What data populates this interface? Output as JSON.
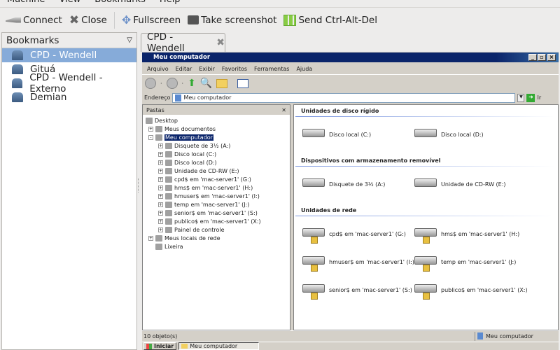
{
  "menubar": [
    "Machine",
    "View",
    "Bookmarks",
    "Help"
  ],
  "toolbar": {
    "connect": "Connect",
    "close": "Close",
    "fullscreen": "Fullscreen",
    "screenshot": "Take screenshot",
    "cad": "Send Ctrl-Alt-Del"
  },
  "bookmarks": {
    "title": "Bookmarks",
    "items": [
      {
        "label": "CPD - Wendell",
        "selected": true
      },
      {
        "label": "Gituá"
      },
      {
        "label": "CPD - Wendell - Externo"
      },
      {
        "label": "Demian"
      }
    ]
  },
  "tab": {
    "label": "CPD - Wendell"
  },
  "remote": {
    "title": "Meu computador",
    "menu": [
      "Arquivo",
      "Editar",
      "Exibir",
      "Favoritos",
      "Ferramentas",
      "Ajuda"
    ],
    "address_label": "Endereço",
    "address": "Meu computador",
    "go": "Ir",
    "folders_title": "Pastas",
    "tree": [
      {
        "label": "Desktop",
        "level": 0,
        "exp": ""
      },
      {
        "label": "Meus documentos",
        "level": 1,
        "exp": "+"
      },
      {
        "label": "Meu computador",
        "level": 1,
        "exp": "-",
        "selected": true
      },
      {
        "label": "Disquete de 3½ (A:)",
        "level": 2,
        "exp": "+"
      },
      {
        "label": "Disco local (C:)",
        "level": 2,
        "exp": "+"
      },
      {
        "label": "Disco local (D:)",
        "level": 2,
        "exp": "+"
      },
      {
        "label": "Unidade de CD-RW (E:)",
        "level": 2,
        "exp": "+"
      },
      {
        "label": "cpd$ em 'mac-server1' (G:)",
        "level": 2,
        "exp": "+"
      },
      {
        "label": "hms$ em 'mac-server1' (H:)",
        "level": 2,
        "exp": "+"
      },
      {
        "label": "hmuser$ em 'mac-server1' (I:)",
        "level": 2,
        "exp": "+"
      },
      {
        "label": "temp em 'mac-server1' (J:)",
        "level": 2,
        "exp": "+"
      },
      {
        "label": "senior$ em 'mac-server1' (S:)",
        "level": 2,
        "exp": "+"
      },
      {
        "label": "publico$ em 'mac-server1' (X:)",
        "level": 2,
        "exp": "+"
      },
      {
        "label": "Painel de controle",
        "level": 2,
        "exp": "+"
      },
      {
        "label": "Meus locais de rede",
        "level": 1,
        "exp": "+"
      },
      {
        "label": "Lixeira",
        "level": 1,
        "exp": ""
      }
    ],
    "sections": [
      {
        "title": "Unidades de disco rígido",
        "items": [
          "Disco local (C:)",
          "Disco local (D:)"
        ]
      },
      {
        "title": "Dispositivos com armazenamento removível",
        "items": [
          "Disquete de 3½ (A:)",
          "Unidade de CD-RW (E:)"
        ]
      },
      {
        "title": "Unidades de rede",
        "items": [
          "cpd$ em 'mac-server1' (G:)",
          "hms$ em 'mac-server1' (H:)",
          "hmuser$ em 'mac-server1' (I:)",
          "temp em 'mac-server1' (J:)",
          "senior$ em 'mac-server1' (S:)",
          "publico$ em 'mac-server1' (X:)"
        ]
      }
    ],
    "status": "10 objeto(s)",
    "status_right": "Meu computador",
    "start": "Iniciar",
    "task": "Meu computador"
  }
}
